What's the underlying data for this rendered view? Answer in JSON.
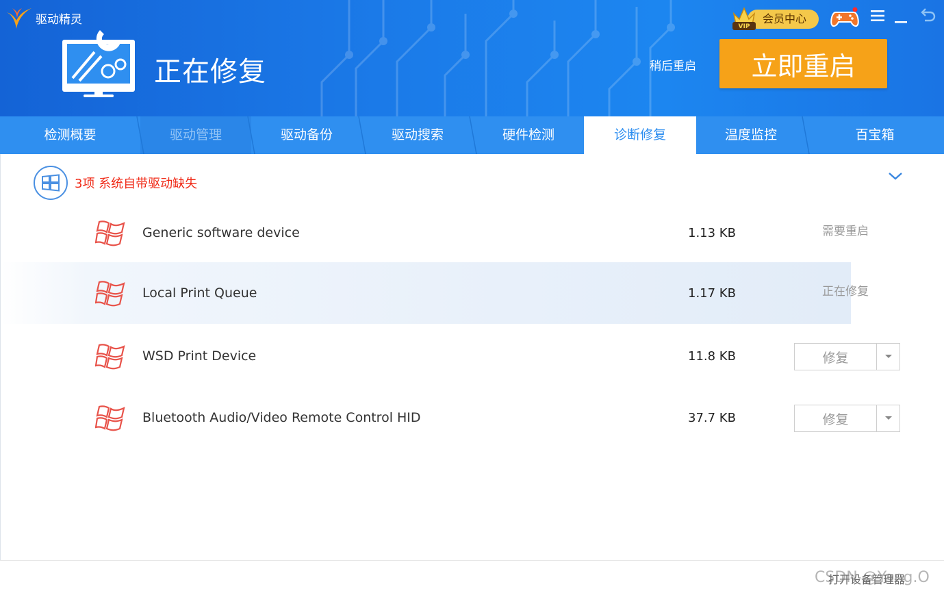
{
  "app": {
    "name": "驱动精灵"
  },
  "header": {
    "title": "正在修复",
    "later_label": "稍后重启",
    "restart_label": "立即重启",
    "vip_label": "会员中心",
    "vip_badge": "VIP"
  },
  "tabs": [
    {
      "label": "检测概要",
      "state": "normal"
    },
    {
      "label": "驱动管理",
      "state": "dim"
    },
    {
      "label": "驱动备份",
      "state": "normal"
    },
    {
      "label": "驱动搜索",
      "state": "normal"
    },
    {
      "label": "硬件检测",
      "state": "normal"
    },
    {
      "label": "诊断修复",
      "state": "active"
    },
    {
      "label": "温度监控",
      "state": "normal"
    },
    {
      "label": "百宝箱",
      "state": "normal"
    }
  ],
  "group": {
    "title": "3项 系统自带驱动缺失"
  },
  "drivers": [
    {
      "name": "Generic software device",
      "size": "1.13 KB",
      "status": "需要重启",
      "action": null
    },
    {
      "name": "Local Print Queue",
      "size": "1.17 KB",
      "status": "正在修复",
      "action": null
    },
    {
      "name": "WSD Print Device",
      "size": "11.8 KB",
      "status": null,
      "action": "修复"
    },
    {
      "name": "Bluetooth Audio/Video Remote Control HID",
      "size": "37.7 KB",
      "status": null,
      "action": "修复"
    }
  ],
  "footer": {
    "link": "打开设备管理器",
    "watermark": "CSDN @Yang.O"
  },
  "colors": {
    "header_blue": "#1b7ae8",
    "tab_blue": "#2f8ff0",
    "restart_orange": "#f6a218",
    "alert_red": "#f02a17",
    "icon_red": "#e8534a"
  },
  "icons": [
    "logo-icon",
    "hero-monitor-icon",
    "vip-crown-icon",
    "gamepad-icon",
    "menu-icon",
    "minimize-icon",
    "back-icon",
    "windows-icon",
    "chevron-down-icon",
    "driver-windows-icon",
    "dropdown-arrow-icon"
  ]
}
